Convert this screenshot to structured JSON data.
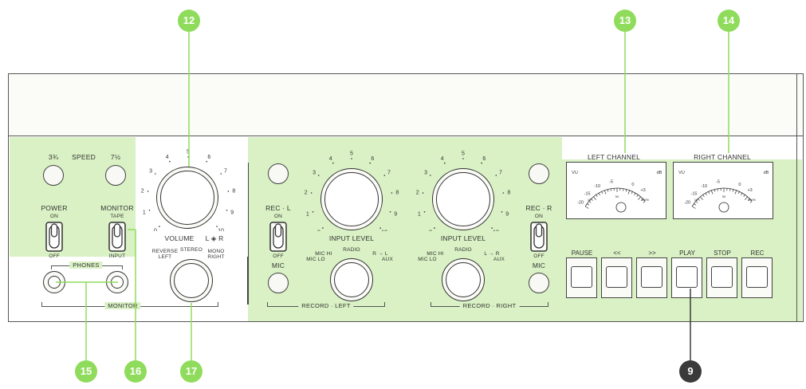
{
  "speed": {
    "label": "SPEED",
    "slow": "3¾",
    "fast": "7½"
  },
  "power": {
    "label": "POWER",
    "on": "ON",
    "off": "OFF"
  },
  "monitor_switch": {
    "label": "MONITOR",
    "top": "TAPE",
    "bottom": "INPUT"
  },
  "phones": {
    "label": "PHONES"
  },
  "monitor_section": {
    "label": "MONITOR"
  },
  "volume": {
    "label": "VOLUME",
    "balance": "L ◈ R",
    "scale": [
      "0",
      "1",
      "2",
      "3",
      "4",
      "5",
      "6",
      "7",
      "8",
      "9",
      "10"
    ]
  },
  "mode_selector": {
    "reverse_left": "REVERSE\nLEFT",
    "stereo": "STEREO",
    "mono_right": "MONO\nRIGHT"
  },
  "rec_left": {
    "label": "REC · L",
    "on": "ON",
    "off": "OFF",
    "mic": "MIC"
  },
  "rec_right": {
    "label": "REC · R",
    "on": "ON",
    "off": "OFF",
    "mic": "MIC"
  },
  "input_left": {
    "label": "INPUT LEVEL",
    "selector": {
      "mic_hi": "MIC HI",
      "mic_lo": "MIC LO",
      "radio": "RADIO",
      "route": "R → L",
      "aux": "AUX"
    },
    "scale": [
      "0",
      "1",
      "2",
      "3",
      "4",
      "5",
      "6",
      "7",
      "8",
      "9",
      "10"
    ]
  },
  "input_right": {
    "label": "INPUT LEVEL",
    "selector": {
      "mic_hi": "MIC HI",
      "mic_lo": "MIC LO",
      "radio": "RADIO",
      "route": "L → R",
      "aux": "AUX"
    },
    "scale": [
      "0",
      "1",
      "2",
      "3",
      "4",
      "5",
      "6",
      "7",
      "8",
      "9",
      "10"
    ]
  },
  "record_left_section": {
    "label": "RECORD · LEFT"
  },
  "record_right_section": {
    "label": "RECORD · RIGHT"
  },
  "meters": {
    "left_title": "LEFT CHANNEL",
    "right_title": "RIGHT CHANNEL",
    "vu": "VU",
    "db": "dB",
    "scale": [
      "-20",
      "-15",
      "-10",
      "-5",
      "0",
      "+3"
    ],
    "sub_scale": [
      "10",
      "50",
      "100%"
    ]
  },
  "transport": [
    "PAUSE",
    "<<",
    ">>",
    "PLAY",
    "STOP",
    "REC"
  ],
  "callouts": [
    "12",
    "13",
    "14",
    "15",
    "16",
    "17",
    "9"
  ],
  "colors": {
    "highlight": "#d9f1c4",
    "callout_green": "#8fdc5c",
    "callout_dark": "#3a3a3a",
    "panel": "#f6f8f1"
  }
}
